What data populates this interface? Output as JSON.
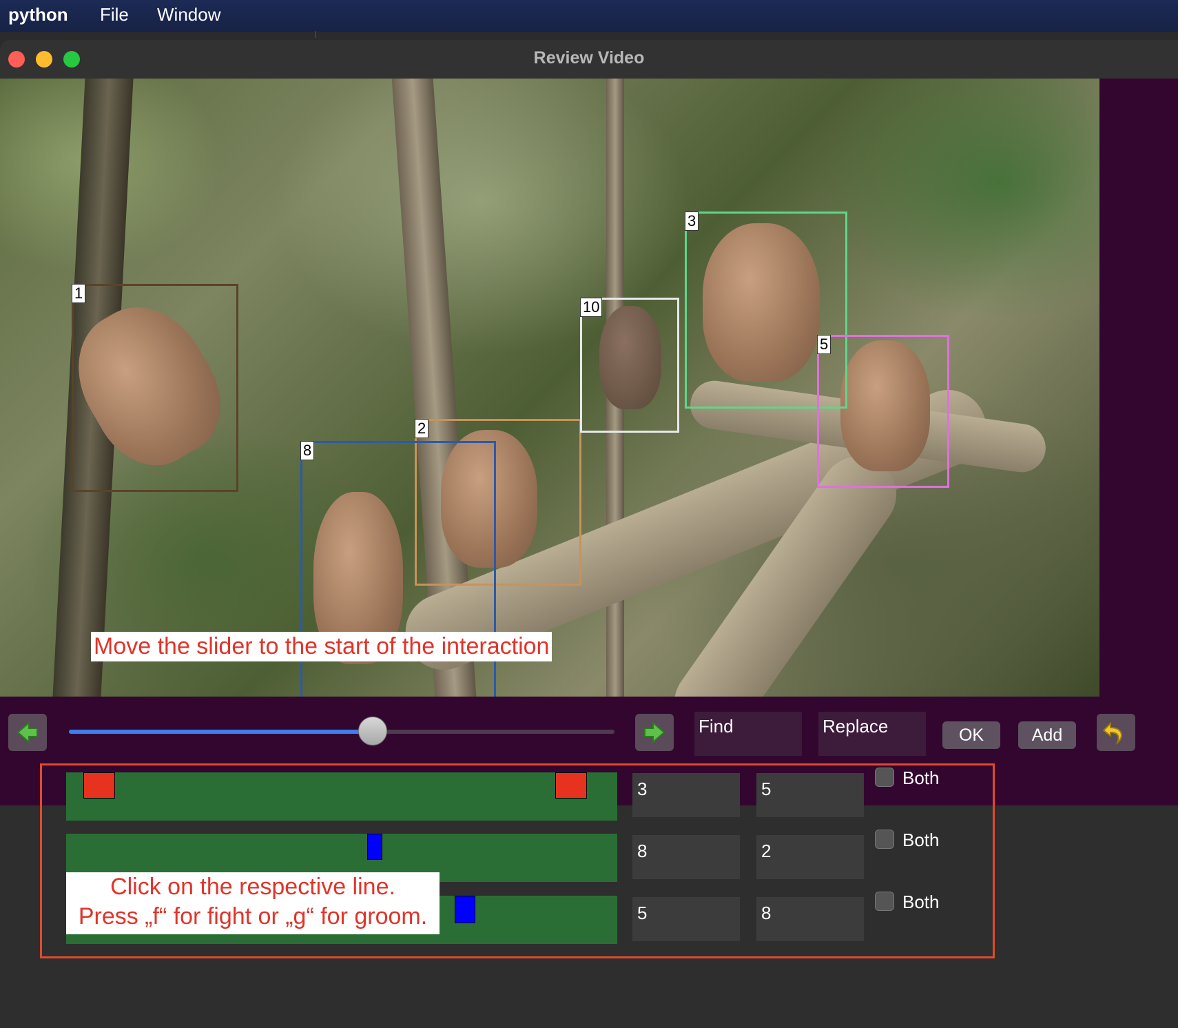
{
  "menubar": {
    "app": "python",
    "file": "File",
    "window": "Window"
  },
  "window": {
    "title": "Review Video"
  },
  "video": {
    "boxes": [
      {
        "id": "1",
        "color": "#5a4328"
      },
      {
        "id": "2",
        "color": "#c8925a"
      },
      {
        "id": "3",
        "color": "#5fd68a"
      },
      {
        "id": "5",
        "color": "#e070e0"
      },
      {
        "id": "8",
        "color": "#2c5aa8"
      },
      {
        "id": "10",
        "color": "#e8e8e8"
      }
    ],
    "instruction": "Move the slider to the start of the interaction"
  },
  "controls": {
    "prev_icon": "left-arrow-icon",
    "next_icon": "right-arrow-icon",
    "slider_position": 0.55,
    "find_placeholder": "Find",
    "replace_placeholder": "Replace",
    "ok_label": "OK",
    "add_label": "Add",
    "undo_icon": "undo-arrow-icon"
  },
  "interactions": [
    {
      "left": "3",
      "right": "5",
      "both_label": "Both",
      "both_checked": false,
      "markers": [
        "red",
        "red"
      ]
    },
    {
      "left": "8",
      "right": "2",
      "both_label": "Both",
      "both_checked": false,
      "markers": [
        "blue"
      ]
    },
    {
      "left": "5",
      "right": "8",
      "both_label": "Both",
      "both_checked": false,
      "markers": [
        "blue"
      ]
    }
  ],
  "instruction2": {
    "line1": "Click on the respective line.",
    "line2": "Press „f“ for fight or „g“ for groom."
  },
  "colors": {
    "marker_red": "#e6321e",
    "marker_blue": "#0000ff",
    "timeline_green": "#2b6e35",
    "highlight_frame": "#e24a2b"
  }
}
